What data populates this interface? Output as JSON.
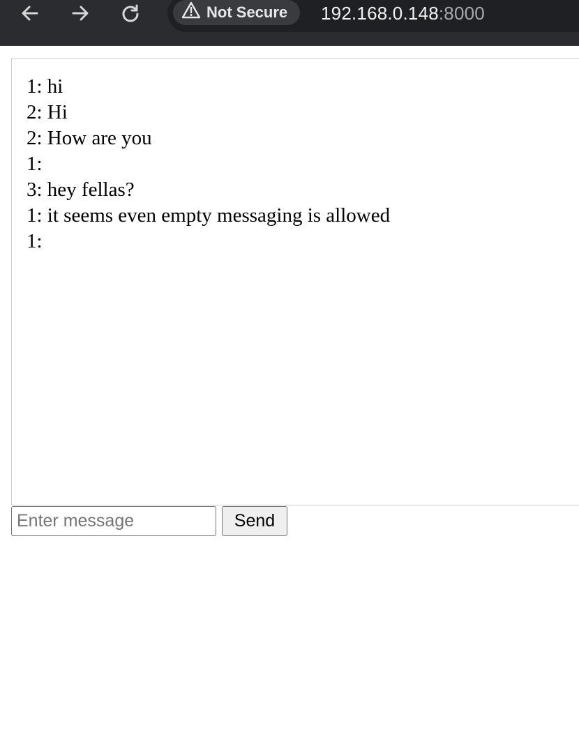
{
  "browser": {
    "back_icon": "arrow-left-icon",
    "forward_icon": "arrow-right-icon",
    "reload_icon": "reload-icon",
    "security_icon": "warning-triangle-icon",
    "security_label": "Not Secure",
    "url_host": "192.168.0.148",
    "url_port": ":8000"
  },
  "chat": {
    "messages": [
      "1: hi",
      "2: Hi",
      "2: How are you",
      "1: ",
      "3: hey fellas?",
      "1: it seems even empty messaging is allowed",
      "1: "
    ]
  },
  "composer": {
    "input_value": "",
    "input_placeholder": "Enter message",
    "send_label": "Send"
  },
  "colors": {
    "toolbar_bg": "#2b2c2f",
    "omnibox_bg": "#1f2023",
    "chip_bg": "#3a3b3f",
    "button_bg": "#efefef",
    "border": "#767676"
  }
}
